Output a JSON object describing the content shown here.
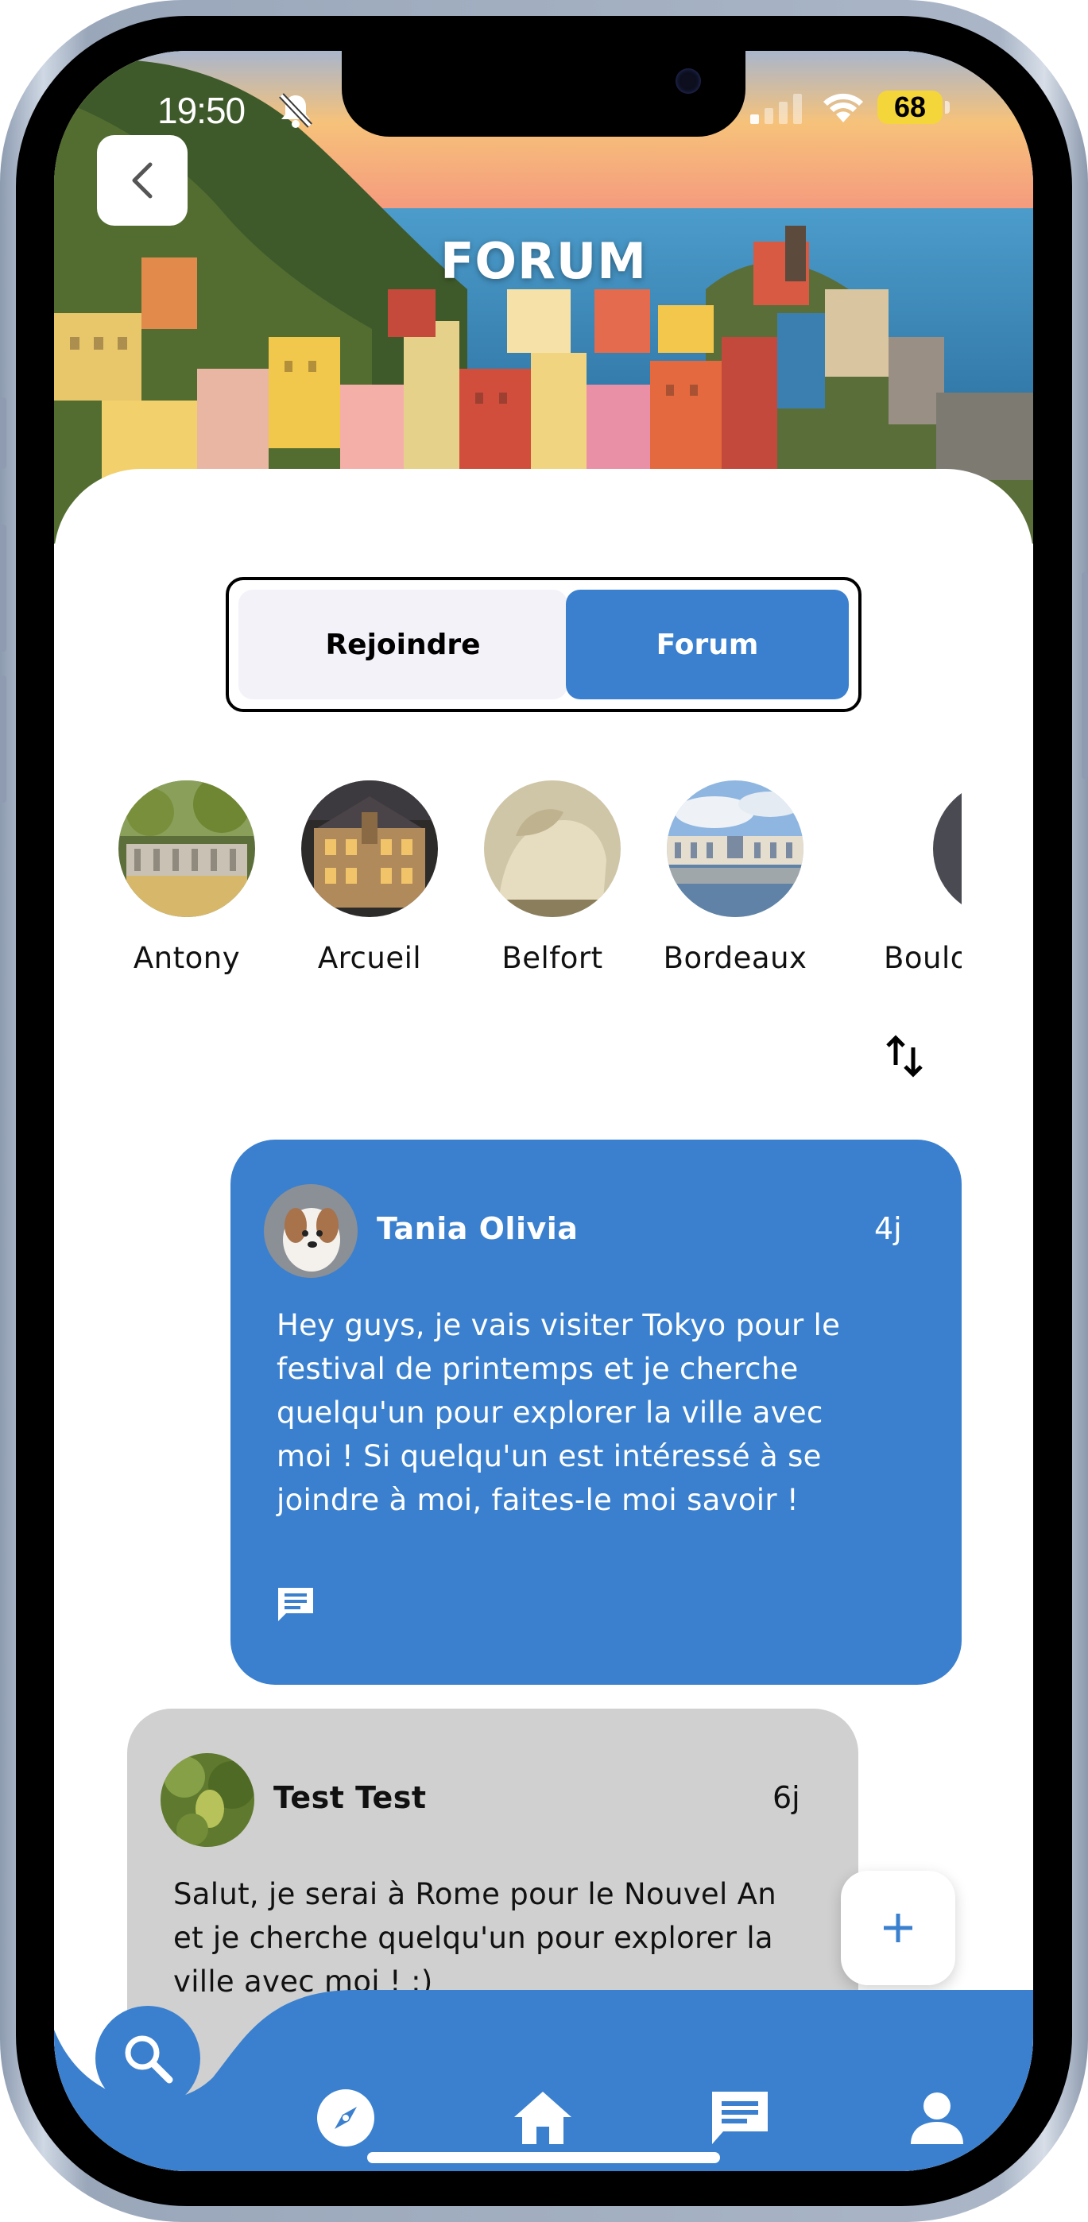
{
  "status_bar": {
    "time": "19:50",
    "battery": "68"
  },
  "header": {
    "title": "FORUM"
  },
  "segmented_control": {
    "join_label": "Rejoindre",
    "forum_label": "Forum",
    "active": "Forum"
  },
  "cities": [
    {
      "name": "Antony"
    },
    {
      "name": "Arcueil"
    },
    {
      "name": "Belfort"
    },
    {
      "name": "Bordeaux"
    },
    {
      "name": "Boulog"
    }
  ],
  "posts": [
    {
      "author": "Tania Olivia",
      "age": "4j",
      "text": "Hey guys, je vais visiter Tokyo pour le festival de printemps et je cherche quelqu'un pour explorer la ville avec moi ! Si quelqu'un est intéressé à se joindre à moi, faites-le moi savoir !",
      "lines": [
        "Hey guys, je vais visiter Tokyo pour le",
        "festival de printemps et je cherche",
        "quelqu'un pour explorer la ville avec",
        "moi ! Si quelqu'un est intéressé à se",
        "joindre à moi, faites-le moi savoir !"
      ]
    },
    {
      "author": "Test Test",
      "age": "6j",
      "text": "Salut, je serai à Rome pour le Nouvel An et je cherche quelqu'un pour explorer la ville avec moi ! :)",
      "lines": [
        "Salut, je serai à Rome pour le Nouvel An",
        "et je cherche quelqu'un pour explorer la",
        "ville avec moi ! :)"
      ]
    }
  ],
  "nav": {
    "items": [
      "search-icon",
      "compass-icon",
      "home-icon",
      "chat-icon",
      "person-icon"
    ]
  },
  "colors": {
    "primary": "#3a80cf",
    "post_secondary": "#d0d0d0",
    "segment_inactive": "#f3f2f8"
  }
}
